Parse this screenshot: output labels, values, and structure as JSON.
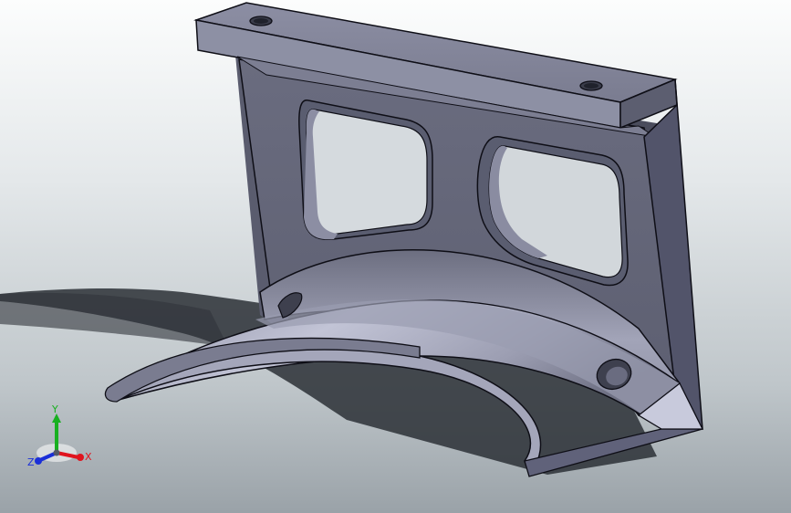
{
  "triad": {
    "x_label": "X",
    "y_label": "Y",
    "z_label": "Z",
    "x_color": "#e0141e",
    "y_color": "#18b020",
    "z_color": "#1a2fd8"
  },
  "model": {
    "face_color": "#7f8194",
    "dark_face_color": "#4a4c5c",
    "light_face_color": "#a6a8bb",
    "edge_color": "#0e0e16"
  },
  "background": {
    "top_color": "#ffffff",
    "bottom_color": "#9ea6ac"
  }
}
